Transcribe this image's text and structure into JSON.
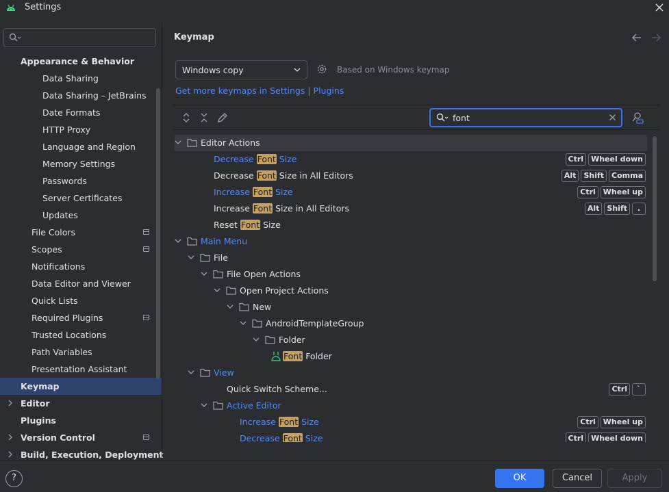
{
  "window": {
    "title": "Settings"
  },
  "sidebar": {
    "search_placeholder": "",
    "items": [
      {
        "label": "Appearance & Behavior",
        "level": 0,
        "bold": true,
        "expanded": true
      },
      {
        "label": "Data Sharing",
        "level": 2
      },
      {
        "label": "Data Sharing – JetBrains",
        "level": 2
      },
      {
        "label": "Date Formats",
        "level": 2
      },
      {
        "label": "HTTP Proxy",
        "level": 2
      },
      {
        "label": "Language and Region",
        "level": 2
      },
      {
        "label": "Memory Settings",
        "level": 2
      },
      {
        "label": "Passwords",
        "level": 2
      },
      {
        "label": "Server Certificates",
        "level": 2
      },
      {
        "label": "Updates",
        "level": 2
      },
      {
        "label": "File Colors",
        "level": 1,
        "project": true
      },
      {
        "label": "Scopes",
        "level": 1,
        "project": true
      },
      {
        "label": "Notifications",
        "level": 1
      },
      {
        "label": "Data Editor and Viewer",
        "level": 1
      },
      {
        "label": "Quick Lists",
        "level": 1
      },
      {
        "label": "Required Plugins",
        "level": 1,
        "project": true
      },
      {
        "label": "Trusted Locations",
        "level": 1
      },
      {
        "label": "Path Variables",
        "level": 1
      },
      {
        "label": "Presentation Assistant",
        "level": 1
      },
      {
        "label": "Keymap",
        "level": 0,
        "bold": true,
        "selected": true
      },
      {
        "label": "Editor",
        "level": 0,
        "bold": true,
        "collapsed": true
      },
      {
        "label": "Plugins",
        "level": 0,
        "bold": true
      },
      {
        "label": "Version Control",
        "level": 0,
        "bold": true,
        "collapsed": true,
        "project": true
      },
      {
        "label": "Build, Execution, Deployment",
        "level": 0,
        "bold": true,
        "collapsed": true
      }
    ]
  },
  "main": {
    "title": "Keymap",
    "keymap_selected": "Windows copy",
    "based_on": "Based on Windows keymap",
    "get_more_link": "Get more keymaps in Settings | Plugins",
    "filter_text": "font",
    "tree": [
      {
        "indent": 0,
        "arrow": "down",
        "folder": true,
        "selected": true,
        "parts": [
          {
            "t": "Editor Actions"
          }
        ]
      },
      {
        "indent": 2,
        "link": true,
        "parts": [
          {
            "t": "Decrease "
          },
          {
            "t": "Font",
            "h": true
          },
          {
            "t": " Size"
          }
        ],
        "keys": [
          "Ctrl",
          "Wheel down"
        ]
      },
      {
        "indent": 2,
        "parts": [
          {
            "t": "Decrease "
          },
          {
            "t": "Font",
            "h": true
          },
          {
            "t": " Size in All Editors"
          }
        ],
        "keys": [
          "Alt",
          "Shift",
          "Comma"
        ]
      },
      {
        "indent": 2,
        "link": true,
        "parts": [
          {
            "t": "Increase "
          },
          {
            "t": "Font",
            "h": true
          },
          {
            "t": " Size"
          }
        ],
        "keys": [
          "Ctrl",
          "Wheel up"
        ]
      },
      {
        "indent": 2,
        "parts": [
          {
            "t": "Increase "
          },
          {
            "t": "Font",
            "h": true
          },
          {
            "t": " Size in All Editors"
          }
        ],
        "keys": [
          "Alt",
          "Shift",
          "."
        ]
      },
      {
        "indent": 2,
        "parts": [
          {
            "t": "Reset "
          },
          {
            "t": "Font",
            "h": true
          },
          {
            "t": " Size"
          }
        ]
      },
      {
        "indent": 0,
        "arrow": "down",
        "folder": true,
        "link": true,
        "parts": [
          {
            "t": "Main Menu"
          }
        ]
      },
      {
        "indent": 1,
        "arrow": "down",
        "folder": true,
        "parts": [
          {
            "t": "File"
          }
        ]
      },
      {
        "indent": 2,
        "arrow": "down",
        "folder": true,
        "parts": [
          {
            "t": "File Open Actions"
          }
        ]
      },
      {
        "indent": 3,
        "arrow": "down",
        "folder": true,
        "parts": [
          {
            "t": "Open Project Actions"
          }
        ]
      },
      {
        "indent": 4,
        "arrow": "down",
        "folder": true,
        "parts": [
          {
            "t": "New"
          }
        ]
      },
      {
        "indent": 5,
        "arrow": "down",
        "folder": true,
        "parts": [
          {
            "t": "AndroidTemplateGroup"
          }
        ]
      },
      {
        "indent": 6,
        "arrow": "down",
        "folder": true,
        "parts": [
          {
            "t": "Folder"
          }
        ]
      },
      {
        "indent": 7,
        "android": true,
        "parts": [
          {
            "t": "Font",
            "h": true
          },
          {
            "t": " Folder"
          }
        ]
      },
      {
        "indent": 1,
        "arrow": "down",
        "folder": true,
        "link": true,
        "parts": [
          {
            "t": "View"
          }
        ]
      },
      {
        "indent": 3,
        "parts": [
          {
            "t": "Quick Switch Scheme..."
          }
        ],
        "keys": [
          "Ctrl",
          "`"
        ]
      },
      {
        "indent": 2,
        "arrow": "down",
        "folder": true,
        "link": true,
        "parts": [
          {
            "t": "Active Editor"
          }
        ]
      },
      {
        "indent": 4,
        "link": true,
        "parts": [
          {
            "t": "Increase "
          },
          {
            "t": "Font",
            "h": true
          },
          {
            "t": " Size"
          }
        ],
        "keys": [
          "Ctrl",
          "Wheel up"
        ]
      },
      {
        "indent": 4,
        "link": true,
        "parts": [
          {
            "t": "Decrease "
          },
          {
            "t": "Font",
            "h": true
          },
          {
            "t": " Size"
          }
        ],
        "keys": [
          "Ctrl",
          "Wheel down"
        ]
      }
    ]
  },
  "footer": {
    "help": "?",
    "ok": "OK",
    "cancel": "Cancel",
    "apply": "Apply"
  },
  "colors": {
    "accent": "#3574f0",
    "link": "#548af7",
    "highlight": "#c8a05a",
    "selection": "#2e436e"
  }
}
